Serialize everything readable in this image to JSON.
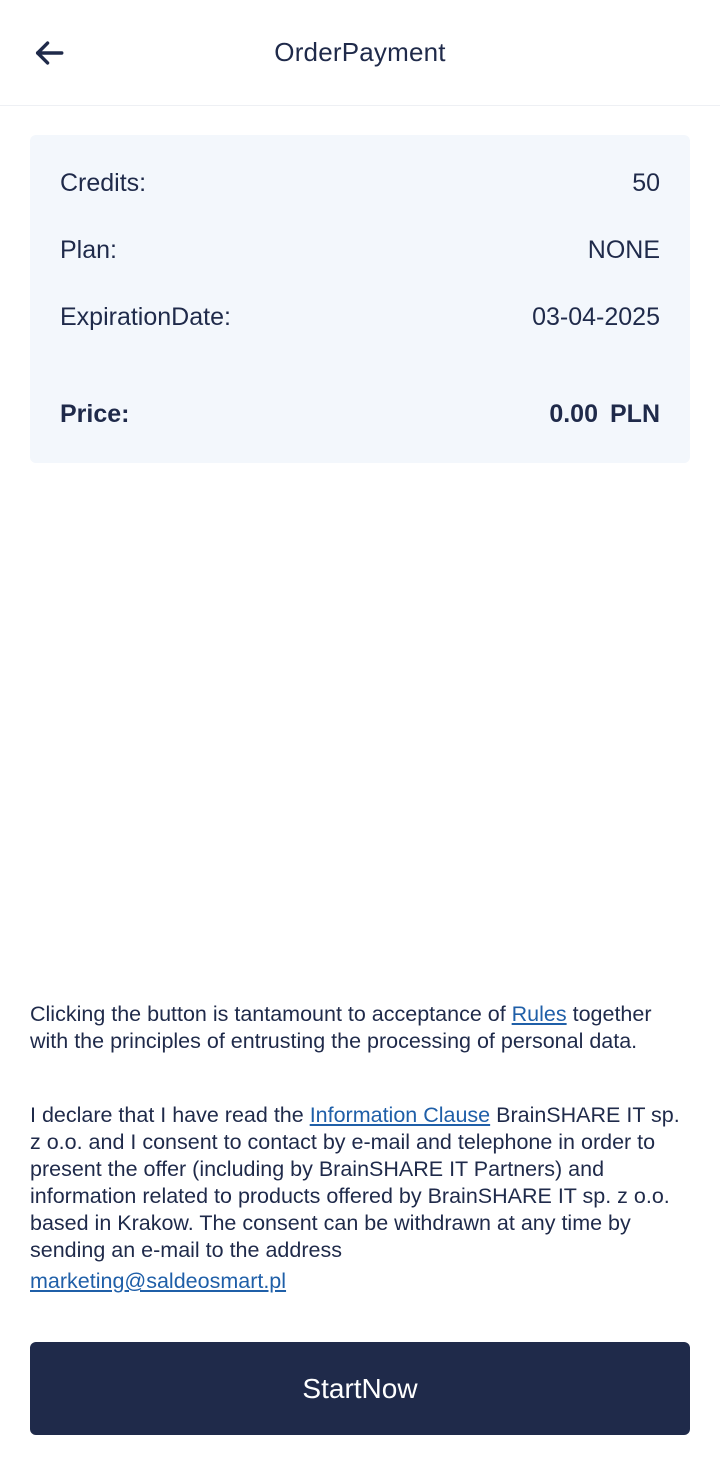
{
  "header": {
    "title": "OrderPayment",
    "back_icon": "arrow-left-icon"
  },
  "summary": {
    "credits_label": "Credits:",
    "credits_value": "50",
    "plan_label": "Plan:",
    "plan_value": "NONE",
    "expiration_label": "ExpirationDate:",
    "expiration_value": "03-04-2025",
    "price_label": "Price:",
    "price_amount": "0.00",
    "price_currency": "PLN"
  },
  "legal": {
    "p1_before": "Clicking the button is tantamount to acceptance of ",
    "p1_link": "Rules",
    "p1_after": " together with the principles of entrusting the processing of personal data.",
    "p2_before": "I declare that I have read the ",
    "p2_link": "Information Clause",
    "p2_after": " BrainSHARE IT sp. z o.o. and I consent to contact by e-mail and telephone in order to present the offer (including by BrainSHARE IT Partners) and information related to products offered by BrainSHARE IT sp. z o.o. based in Krakow. The consent can be withdrawn at any time by sending an e-mail to the address",
    "p2_email": "marketing@saldeosmart.pl"
  },
  "actions": {
    "start_label": "StartNow"
  },
  "colors": {
    "primary": "#1f2a4a",
    "card_bg": "#f3f7fc",
    "link": "#1f5fa8"
  }
}
